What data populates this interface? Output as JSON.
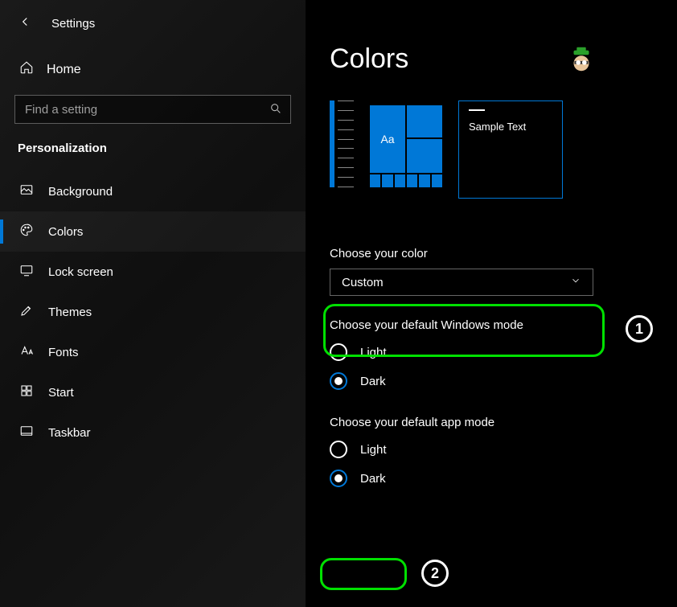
{
  "topbar": {
    "title": "Settings"
  },
  "home": {
    "label": "Home"
  },
  "search": {
    "placeholder": "Find a setting"
  },
  "section": {
    "label": "Personalization"
  },
  "nav": [
    {
      "id": "background",
      "label": "Background"
    },
    {
      "id": "colors",
      "label": "Colors",
      "active": true
    },
    {
      "id": "lock-screen",
      "label": "Lock screen"
    },
    {
      "id": "themes",
      "label": "Themes"
    },
    {
      "id": "fonts",
      "label": "Fonts"
    },
    {
      "id": "start",
      "label": "Start"
    },
    {
      "id": "taskbar",
      "label": "Taskbar"
    }
  ],
  "page": {
    "title": "Colors"
  },
  "preview": {
    "aa": "Aa",
    "sample": "Sample Text"
  },
  "color_select": {
    "label": "Choose your color",
    "value": "Custom"
  },
  "windows_mode": {
    "label": "Choose your default Windows mode",
    "options": {
      "light": "Light",
      "dark": "Dark"
    },
    "selected": "dark"
  },
  "app_mode": {
    "label": "Choose your default app mode",
    "options": {
      "light": "Light",
      "dark": "Dark"
    },
    "selected": "dark"
  },
  "annotations": {
    "1": "1",
    "2": "2"
  },
  "colors": {
    "accent": "#0078d7",
    "highlight": "#00e000"
  }
}
